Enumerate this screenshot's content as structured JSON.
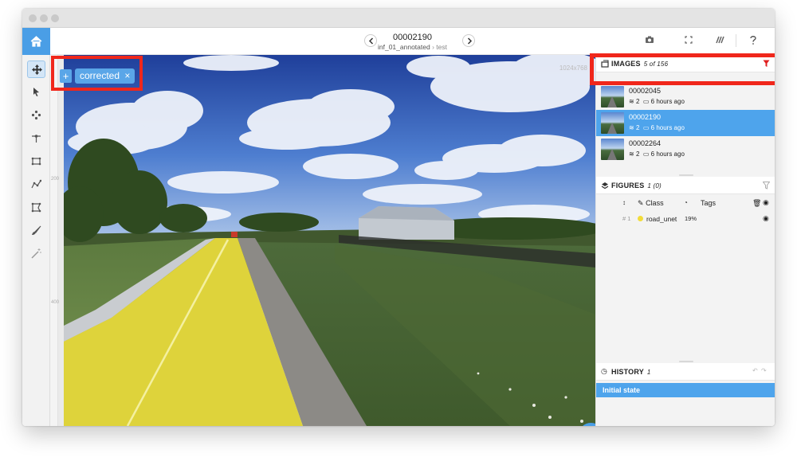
{
  "header": {
    "image_name": "00002190",
    "project": "inf_01_annotated",
    "dataset": "test",
    "separator": "›"
  },
  "canvas": {
    "tag_add": "+",
    "tag_label": "corrected",
    "tag_remove": "×",
    "image_size": "1024x768",
    "ruler_marks": [
      "200",
      "400"
    ]
  },
  "images_panel": {
    "title": "IMAGES",
    "count": "5 of 156",
    "items": [
      {
        "name": "00002045",
        "figures": "2",
        "time": "6 hours ago"
      },
      {
        "name": "00002190",
        "figures": "2",
        "time": "6 hours ago",
        "selected": true
      },
      {
        "name": "00002264",
        "figures": "2",
        "time": "6 hours ago"
      }
    ]
  },
  "figures_panel": {
    "title": "FIGURES",
    "count": "1 (0)",
    "col_class": "Class",
    "col_tags": "Tags",
    "rows": [
      {
        "index": "# 1",
        "class": "road_unet",
        "color": "#f2dc3a",
        "area": "19%"
      }
    ]
  },
  "history_panel": {
    "title": "HISTORY",
    "count": "1",
    "items": [
      "Initial state"
    ]
  },
  "colors": {
    "accent": "#4a9ee6",
    "highlight_box": "#f0271b",
    "mask": "#ded33b"
  },
  "icons": {
    "toolbar": [
      "camera-icon",
      "fullscreen-icon",
      "brush-settings-icon",
      "help-icon",
      "logout-icon"
    ],
    "tools": [
      "move-icon",
      "pointer-icon",
      "smart-tool-icon",
      "point-tool-icon",
      "rectangle-icon",
      "polyline-icon",
      "polygon-icon",
      "brush-icon",
      "magic-wand-icon"
    ]
  }
}
